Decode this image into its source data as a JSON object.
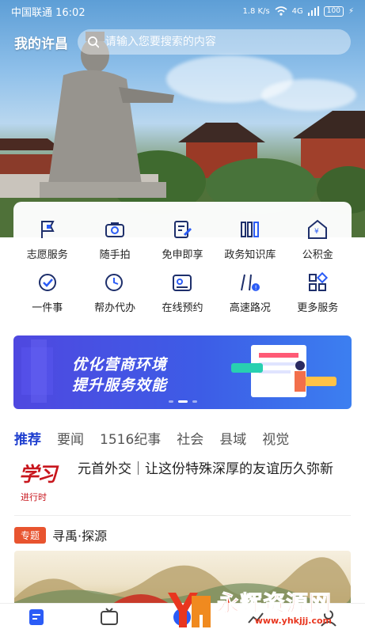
{
  "status_bar": {
    "carrier_time": "中国联通 16:02",
    "speed": "1.8 K/s",
    "signal": "4G",
    "battery": "100"
  },
  "header": {
    "city": "我的许昌",
    "search_placeholder": "请输入您要搜索的内容"
  },
  "services": [
    {
      "label": "志愿服务",
      "icon": "flag-icon"
    },
    {
      "label": "随手拍",
      "icon": "camera-icon"
    },
    {
      "label": "免申即享",
      "icon": "form-edit-icon"
    },
    {
      "label": "政务知识库",
      "icon": "books-icon"
    },
    {
      "label": "公积金",
      "icon": "house-yen-icon"
    },
    {
      "label": "一件事",
      "icon": "check-circle-icon"
    },
    {
      "label": "帮办代办",
      "icon": "clock-person-icon"
    },
    {
      "label": "在线预约",
      "icon": "calendar-icon"
    },
    {
      "label": "高速路况",
      "icon": "road-alert-icon"
    },
    {
      "label": "更多服务",
      "icon": "grid-more-icon"
    }
  ],
  "banner": {
    "line1": "优化营商环境",
    "line2": "提升服务效能"
  },
  "tabs": [
    "推荐",
    "要闻",
    "1516纪事",
    "社会",
    "县域",
    "视觉"
  ],
  "news": {
    "logo_big": "学习",
    "logo_small": "进行时",
    "title": "元首外交｜让这份特殊深厚的友谊历久弥新"
  },
  "topic": {
    "badge": "专题",
    "title": "寻禹·探源"
  },
  "watermark": {
    "text": "永辉资源网",
    "url": "www.yhkjjj.com"
  },
  "colors": {
    "accent": "#1f3fcf",
    "brand_red": "#c8161d",
    "badge": "#e8542f"
  }
}
